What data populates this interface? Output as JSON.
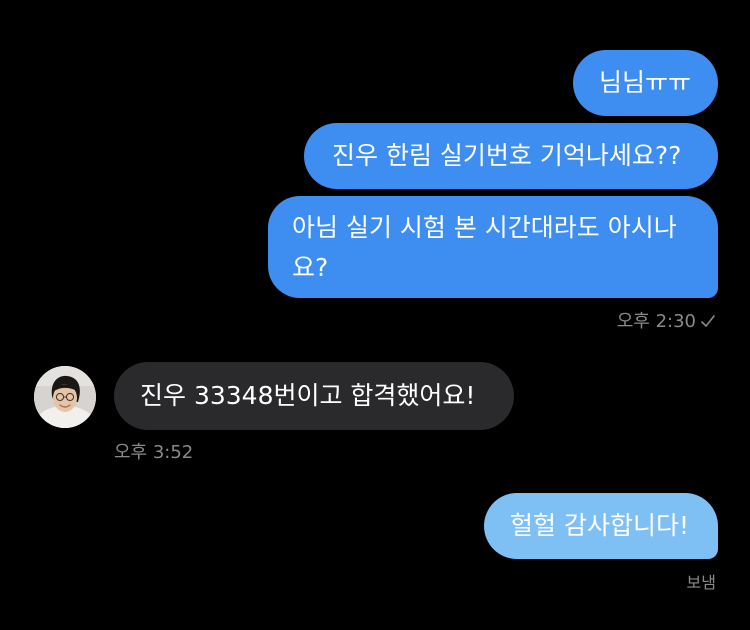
{
  "conversation": {
    "messages": [
      {
        "direction": "outgoing",
        "text": "님님ㅠㅠ"
      },
      {
        "direction": "outgoing",
        "text": "진우 한림 실기번호 기억나세요??"
      },
      {
        "direction": "outgoing",
        "text": "아님 실기 시험 본 시간대라도 아시나요?"
      },
      {
        "direction": "incoming",
        "text": "진우 33348번이고 합격했어요!"
      },
      {
        "direction": "outgoing",
        "text": "헐헐 감사합니다!"
      }
    ],
    "outgoing_time": "오후 2:30",
    "incoming_time": "오후 3:52",
    "delivery_status": "보냄"
  },
  "colors": {
    "background": "#000000",
    "outgoing_bubble": "#3d8ef0",
    "outgoing_bubble_pending": "#7ec0f4",
    "incoming_bubble": "#2a2a2c",
    "meta_text": "#8a8a8e"
  },
  "icons": {
    "read_receipt": "checkmark-icon",
    "sender_avatar": "avatar"
  }
}
